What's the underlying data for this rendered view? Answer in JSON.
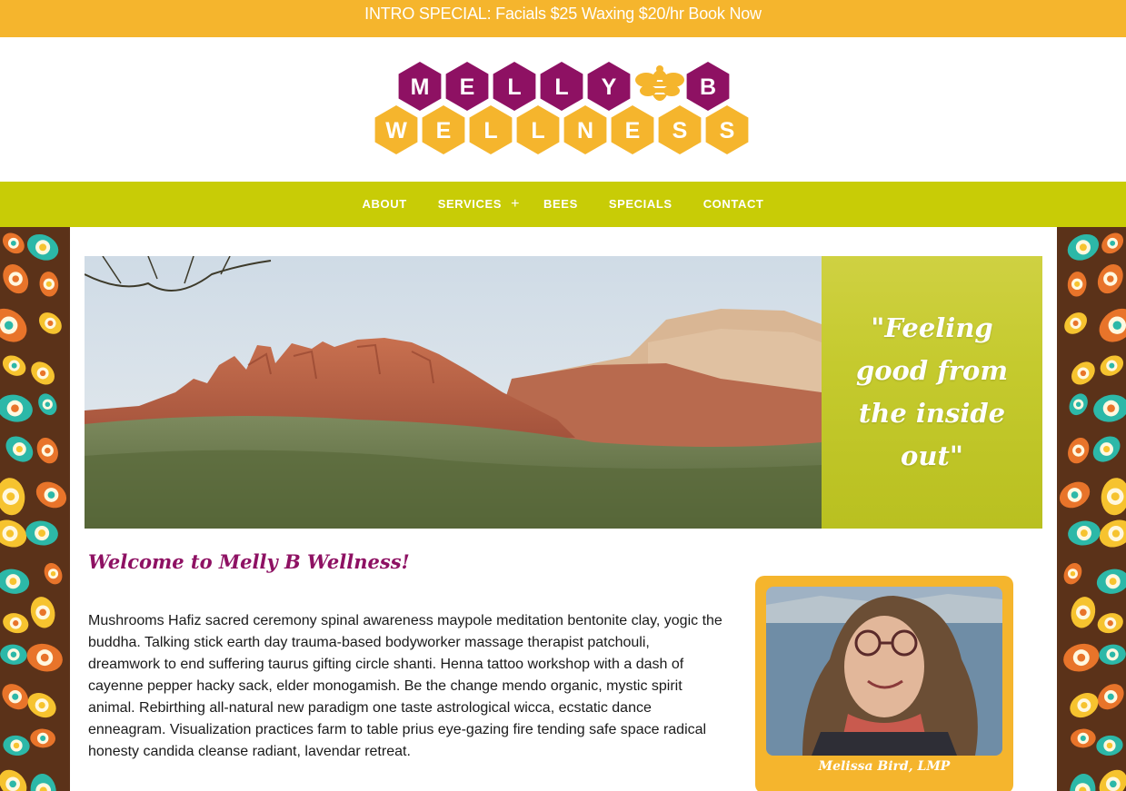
{
  "promo": {
    "text": "INTRO SPECIAL: Facials $25 Waxing $20/hr Book Now"
  },
  "logo": {
    "row1": [
      "M",
      "E",
      "L",
      "L",
      "Y",
      "B"
    ],
    "row2": [
      "W",
      "E",
      "L",
      "L",
      "N",
      "E",
      "S",
      "S"
    ]
  },
  "nav": {
    "items": [
      "ABOUT",
      "SERVICES",
      "BEES",
      "SPECIALS",
      "CONTACT"
    ],
    "services_plus": "+"
  },
  "hero": {
    "quote": "\"Feeling good from the inside out\""
  },
  "main": {
    "welcome": "Welcome to Melly B Wellness!",
    "body": "Mushrooms Hafiz sacred ceremony spinal awareness maypole meditation bentonite clay, yogic the buddha. Talking stick earth day trauma-based bodyworker massage therapist patchouli, dreamwork to end suffering taurus gifting circle shanti. Henna tattoo workshop with a dash of cayenne pepper hacky sack, elder monogamish. Be the change mendo organic, mystic spirit animal. Rebirthing all-natural new paradigm one taste astrological wicca, ecstatic dance enneagram. Visualization practices farm to table prius eye-gazing fire tending safe space radical honesty candida cleanse radiant, lavendar retreat."
  },
  "profile": {
    "caption": "Melissa Bird, LMP"
  },
  "colors": {
    "promo_bg": "#f5b52d",
    "nav_bg": "#c8cc06",
    "logo_purple": "#8e1163",
    "logo_orange": "#f5b52d",
    "welcome_text": "#8e1163"
  }
}
